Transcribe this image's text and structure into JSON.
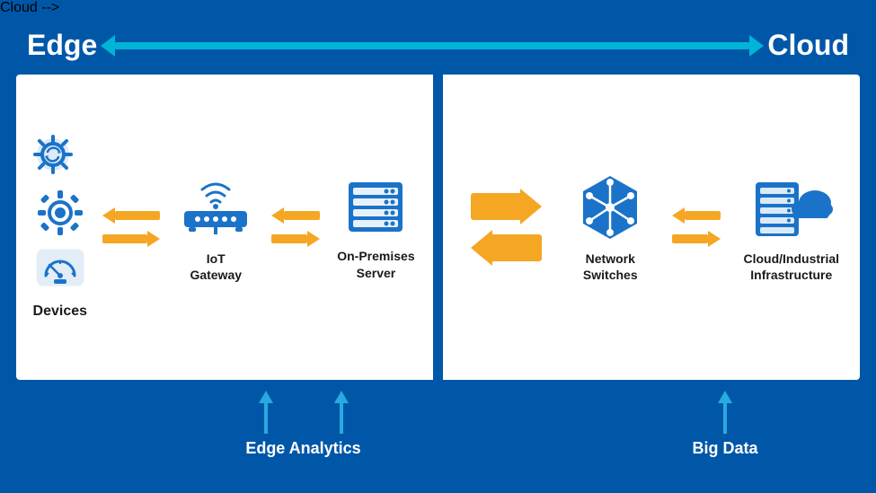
{
  "header": {
    "edge_label": "Edge",
    "cloud_label": "Cloud"
  },
  "diagram": {
    "left_panel": {
      "devices_label": "Devices",
      "iot_gateway_label": "IoT\nGateway",
      "on_premises_label": "On-Premises\nServer"
    },
    "right_panel": {
      "network_label": "Network\nSwitches",
      "cloud_label": "Cloud/Industrial\nInfrastructure"
    }
  },
  "bottom": {
    "edge_analytics_label": "Edge Analytics",
    "big_data_label": "Big Data"
  },
  "colors": {
    "background": "#0057a8",
    "panel_bg": "#ffffff",
    "icon_blue": "#1a73c8",
    "arrow_orange": "#f5a623",
    "arrow_blue": "#29a9e0",
    "text_dark": "#1a1a1a",
    "text_white": "#ffffff"
  }
}
